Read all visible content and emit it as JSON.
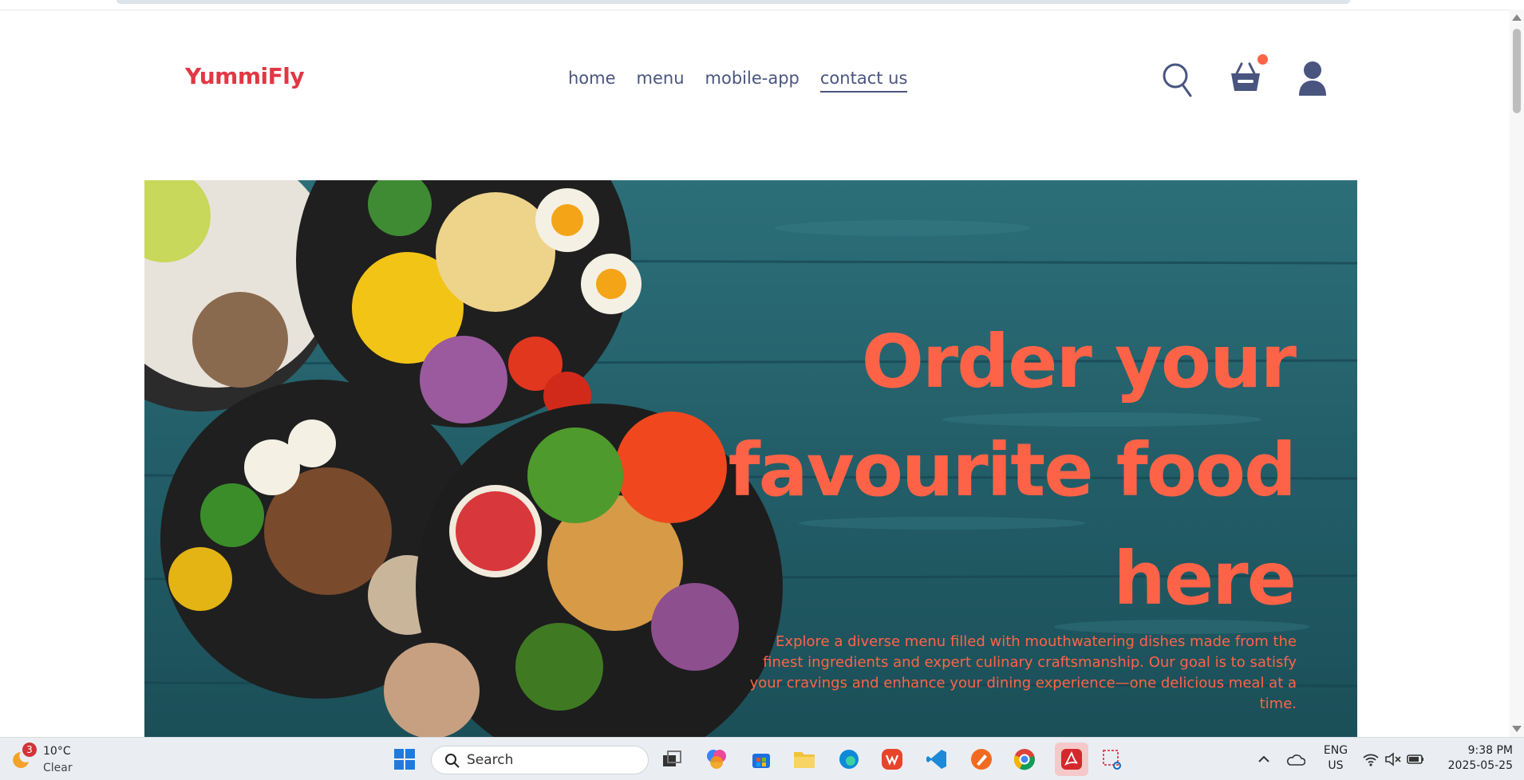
{
  "brand": {
    "logo": "YummiFly",
    "accent_color": "#e23744",
    "hero_text_color": "#ff6347",
    "nav_color": "#49557e"
  },
  "nav": {
    "items": [
      {
        "label": "home",
        "active": false
      },
      {
        "label": "menu",
        "active": false
      },
      {
        "label": "mobile-app",
        "active": false
      },
      {
        "label": "contact us",
        "active": true
      }
    ]
  },
  "header_icons": [
    "search-icon",
    "basket-icon",
    "user-icon"
  ],
  "hero": {
    "title": "Order your favourite food here",
    "description": "Explore a diverse menu filled with mouthwatering dishes made from the finest ingredients and expert culinary craftsmanship. Our goal is to satisfy your cravings and enhance your dining experience—one delicious meal at a time."
  },
  "taskbar": {
    "weather": {
      "badge": "3",
      "temp": "10°C",
      "condition": "Clear"
    },
    "search_placeholder": "Search",
    "apps": [
      "windows-start",
      "task-view",
      "copilot",
      "store",
      "file-explorer",
      "edge",
      "wps",
      "vscode",
      "sketch-tool",
      "chrome",
      "acrobat",
      "snipping-tool"
    ],
    "language": {
      "line1": "ENG",
      "line2": "US"
    },
    "clock": {
      "time": "9:38 PM",
      "date": "2025-05-25"
    }
  }
}
